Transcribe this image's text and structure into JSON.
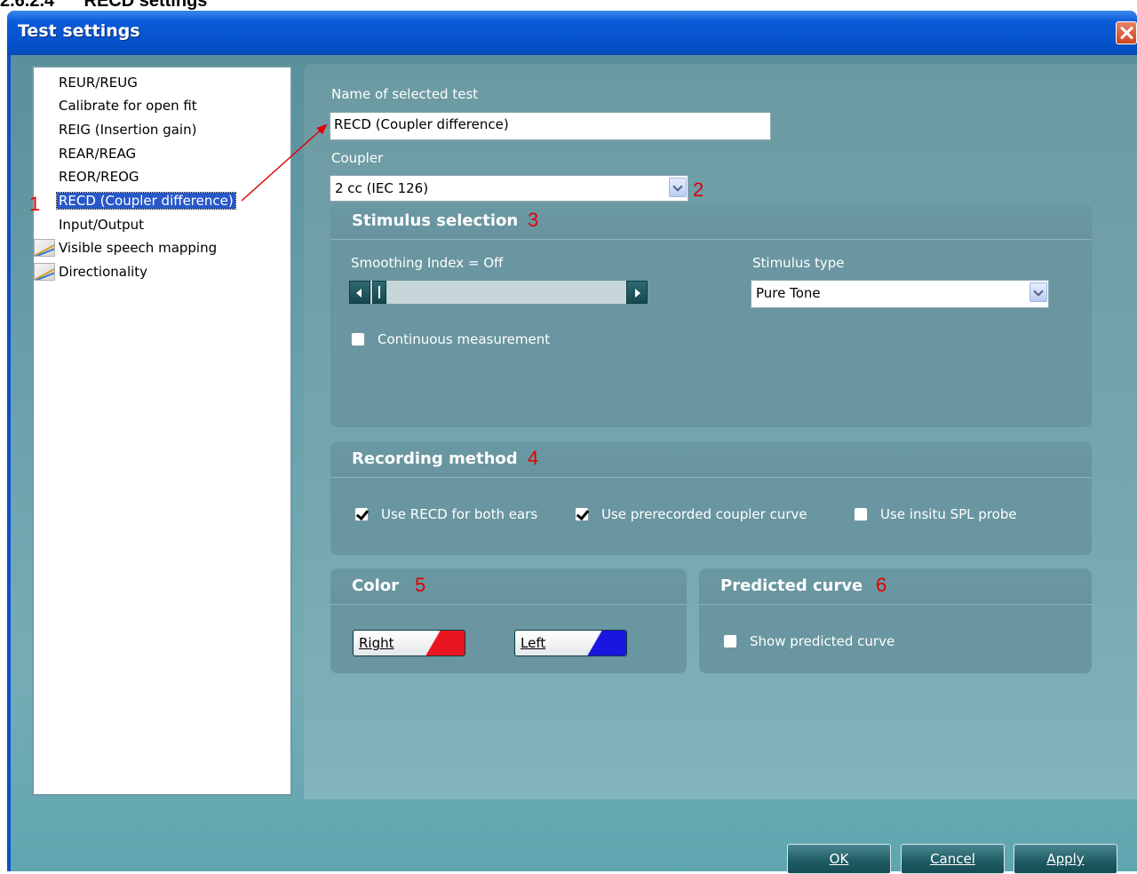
{
  "doc_heading": "2.6.2.4      RECD settings",
  "window": {
    "title": "Test settings"
  },
  "tree": {
    "items": [
      {
        "label": "REUR/REUG",
        "selected": false,
        "icon": null
      },
      {
        "label": "Calibrate for open fit",
        "selected": false,
        "icon": null
      },
      {
        "label": "REIG (Insertion gain)",
        "selected": false,
        "icon": null
      },
      {
        "label": "REAR/REAG",
        "selected": false,
        "icon": null
      },
      {
        "label": "REOR/REOG",
        "selected": false,
        "icon": null
      },
      {
        "label": "RECD (Coupler difference)",
        "selected": true,
        "icon": null
      },
      {
        "label": "Input/Output",
        "selected": false,
        "icon": null
      },
      {
        "label": "Visible speech mapping",
        "selected": false,
        "icon": "graph-icon"
      },
      {
        "label": "Directionality",
        "selected": false,
        "icon": "graph-icon"
      }
    ]
  },
  "annotations": {
    "n1": "1",
    "n2": "2",
    "n3": "3",
    "n4": "4",
    "n5": "5",
    "n6": "6"
  },
  "name_section": {
    "label": "Name of selected test",
    "value": "RECD (Coupler difference)"
  },
  "coupler": {
    "label": "Coupler",
    "value": "2 cc (IEC 126)"
  },
  "stimulus": {
    "title": "Stimulus selection",
    "smoothing_label": "Smoothing Index = Off",
    "smoothing_value": 0,
    "stimulus_type_label": "Stimulus type",
    "stimulus_type_value": "Pure Tone",
    "continuous_label": "Continuous measurement",
    "continuous_checked": false
  },
  "recording": {
    "title": "Recording method",
    "options": [
      {
        "label": "Use RECD for both ears",
        "checked": true
      },
      {
        "label": "Use prerecorded coupler curve",
        "checked": true
      },
      {
        "label": "Use insitu SPL probe",
        "checked": false
      }
    ]
  },
  "color": {
    "title": "Color",
    "right_label": "Right",
    "right_color": "#e8141e",
    "left_label": "Left",
    "left_color": "#1a14e0"
  },
  "predicted": {
    "title": "Predicted curve",
    "show_label": "Show predicted curve",
    "show_checked": false
  },
  "buttons": {
    "ok": "OK",
    "cancel": "Cancel",
    "apply": "Apply"
  },
  "colors": {
    "title_bar": "#0a5ad8",
    "panel": "#6a9aa3",
    "accent": "#e00000",
    "selection": "#2858c8"
  }
}
